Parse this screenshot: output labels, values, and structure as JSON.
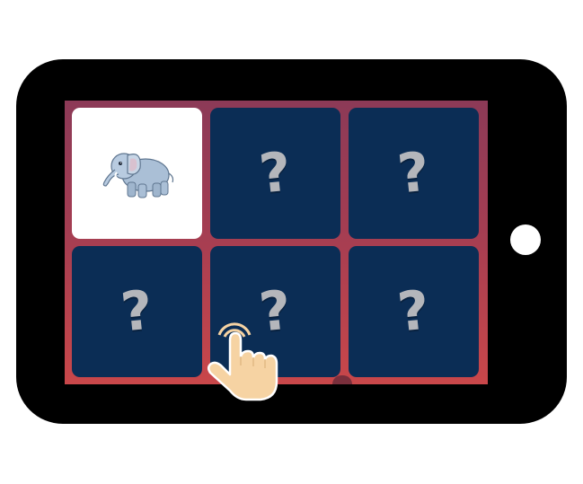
{
  "game": {
    "colors": {
      "device": "#000000",
      "board_top": "#8c3a57",
      "board_bottom": "#c9474a",
      "card_back": "#0b2d55",
      "card_face": "#ffffff",
      "question_mark": "#b4b6bb",
      "hand": "#f6d3a3"
    },
    "cards": [
      {
        "state": "face-up",
        "icon": "elephant-icon"
      },
      {
        "state": "face-down",
        "label": "?"
      },
      {
        "state": "face-down",
        "label": "?"
      },
      {
        "state": "face-down",
        "label": "?"
      },
      {
        "state": "face-down",
        "label": "?"
      },
      {
        "state": "face-down",
        "label": "?"
      }
    ],
    "pointer_icon": "tap-hand-icon"
  }
}
